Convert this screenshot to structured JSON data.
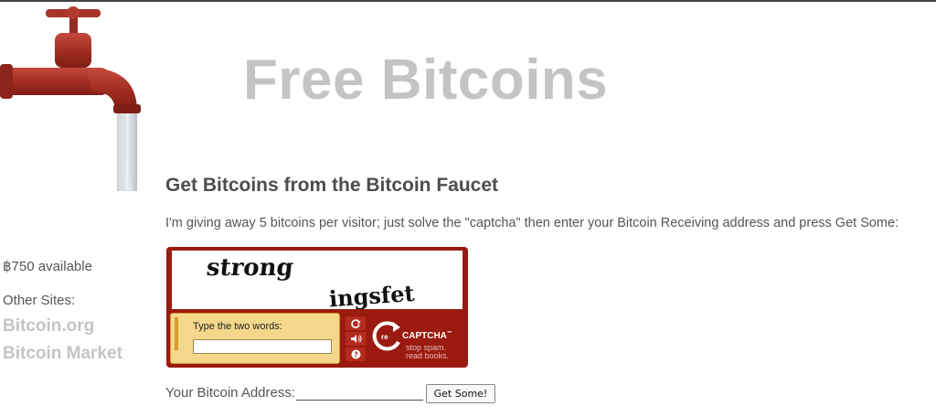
{
  "header": {
    "title": "Free Bitcoins"
  },
  "main": {
    "heading": "Get Bitcoins from the Bitcoin Faucet",
    "intro": "I'm giving away 5 bitcoins per visitor; just solve the \"captcha\" then enter your Bitcoin Receiving address and press Get Some:"
  },
  "sidebar": {
    "available": "฿750 available",
    "other_sites_label": "Other Sites:",
    "links": [
      "Bitcoin.org",
      "Bitcoin Market"
    ]
  },
  "captcha": {
    "words": [
      "strong",
      "ingsfet"
    ],
    "prompt": "Type the two words:",
    "brand_prefix": "re",
    "brand_name": "CAPTCHA",
    "tagline_line1": "stop spam.",
    "tagline_line2": "read books."
  },
  "form": {
    "address_label": "Your Bitcoin Address:",
    "submit_label": "Get Some!"
  },
  "icons": [
    "faucet-icon",
    "reload-icon",
    "audio-icon",
    "help-icon",
    "recaptcha-logo-icon"
  ],
  "colors": {
    "title_gray": "#c4c4c4",
    "recaptcha_red": "#9b1a10",
    "answer_yellow": "#f4d78a"
  }
}
